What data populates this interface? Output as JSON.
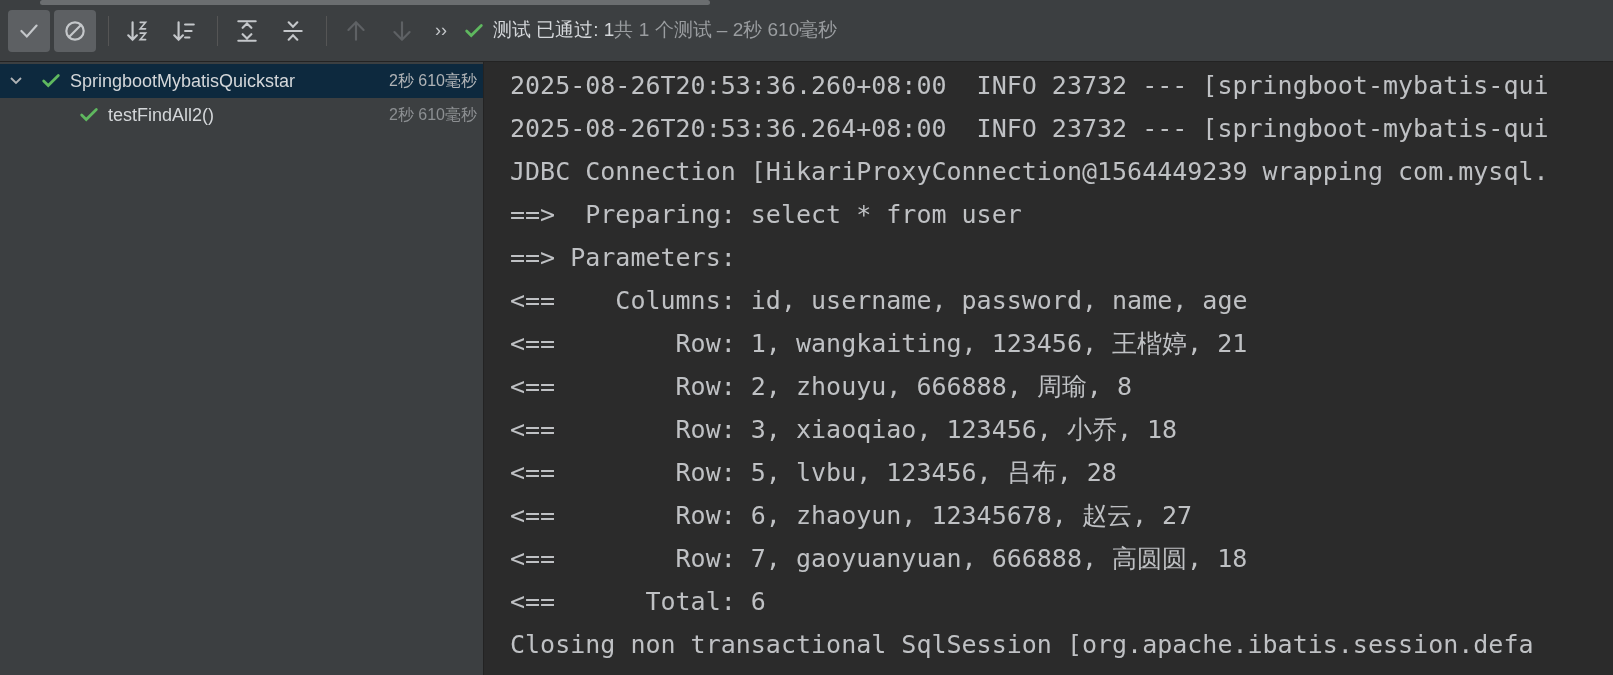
{
  "toolbar": {
    "buttons": [
      {
        "kind": "check",
        "selected": true,
        "disabled": false
      },
      {
        "kind": "ban",
        "selected": true,
        "disabled": false
      },
      {
        "kind": "sort-alpha",
        "selected": false,
        "disabled": false
      },
      {
        "kind": "sort-duration",
        "selected": false,
        "disabled": false
      },
      {
        "kind": "expand",
        "selected": false,
        "disabled": false
      },
      {
        "kind": "collapse",
        "selected": false,
        "disabled": false
      },
      {
        "kind": "up",
        "selected": false,
        "disabled": true
      },
      {
        "kind": "down",
        "selected": false,
        "disabled": true
      }
    ],
    "more": "››",
    "status": {
      "passed": "测试 已通过: 1",
      "summary": "共 1 个测试 – 2秒 610毫秒"
    }
  },
  "tree": [
    {
      "label": "SpringbootMybatisQuickstar",
      "time": "2秒 610毫秒",
      "expanded": true,
      "selected": true,
      "children": [
        {
          "label": "testFindAll2()",
          "time": "2秒 610毫秒",
          "selected": false
        }
      ]
    }
  ],
  "console": [
    "2025-08-26T20:53:36.260+08:00  INFO 23732 --- [springboot-mybatis-qui",
    "2025-08-26T20:53:36.264+08:00  INFO 23732 --- [springboot-mybatis-qui",
    "JDBC Connection [HikariProxyConnection@1564449239 wrapping com.mysql.",
    "==>  Preparing: select * from user",
    "==> Parameters: ",
    "<==    Columns: id, username, password, name, age",
    "<==        Row: 1, wangkaiting, 123456, 王楷婷, 21",
    "<==        Row: 2, zhouyu, 666888, 周瑜, 8",
    "<==        Row: 3, xiaoqiao, 123456, 小乔, 18",
    "<==        Row: 5, lvbu, 123456, 吕布, 28",
    "<==        Row: 6, zhaoyun, 12345678, 赵云, 27",
    "<==        Row: 7, gaoyuanyuan, 666888, 高圆圆, 18",
    "<==      Total: 6",
    "Closing non transactional SqlSession [org.apache.ibatis.session.defa"
  ]
}
